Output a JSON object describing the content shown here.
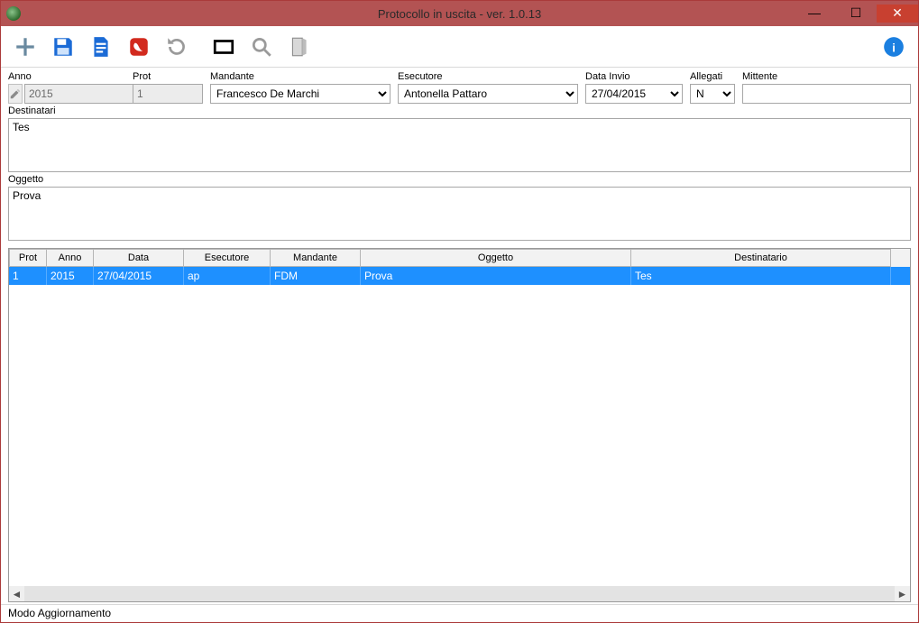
{
  "window": {
    "title": "Protocollo in uscita - ver. 1.0.13"
  },
  "toolbar": {
    "new": "new",
    "save": "save",
    "open": "open",
    "pdf": "pdf",
    "refresh": "refresh",
    "fullscreen": "fullscreen",
    "search": "search",
    "exit": "exit",
    "info": "info"
  },
  "fields": {
    "anno": {
      "label": "Anno",
      "value": "2015"
    },
    "prot": {
      "label": "Prot",
      "value": "1"
    },
    "mandante": {
      "label": "Mandante",
      "value": "Francesco De Marchi"
    },
    "esecutore": {
      "label": "Esecutore",
      "value": "Antonella Pattaro"
    },
    "data_invio": {
      "label": "Data Invio",
      "value": "27/04/2015"
    },
    "allegati": {
      "label": "Allegati",
      "value": "N"
    },
    "mittente": {
      "label": "Mittente",
      "value": ""
    },
    "destinatari": {
      "label": "Destinatari",
      "value": "Tes"
    },
    "oggetto": {
      "label": "Oggetto",
      "value": "Prova"
    }
  },
  "grid": {
    "headers": {
      "prot": "Prot",
      "anno": "Anno",
      "data": "Data",
      "esecutore": "Esecutore",
      "mandante": "Mandante",
      "oggetto": "Oggetto",
      "destinatario": "Destinatario"
    },
    "rows": [
      {
        "prot": "1",
        "anno": "2015",
        "data": "27/04/2015",
        "esecutore": "ap",
        "mandante": "FDM",
        "oggetto": "Prova",
        "destinatario": "Tes"
      }
    ]
  },
  "status": {
    "text": "Modo Aggiornamento"
  }
}
